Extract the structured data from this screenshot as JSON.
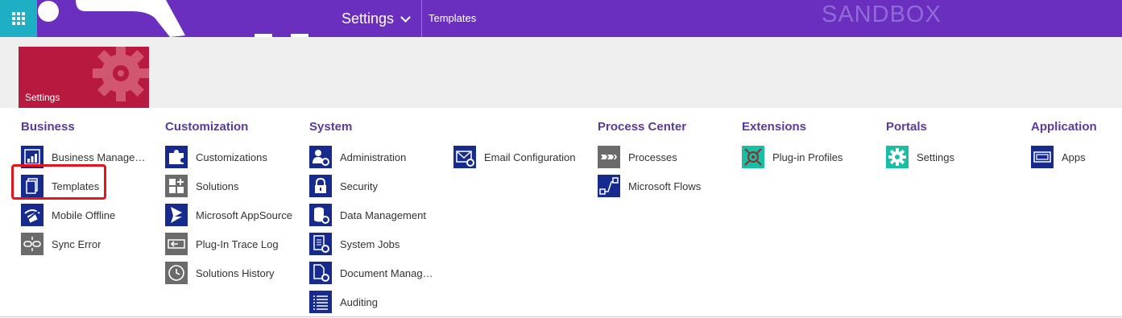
{
  "topbar": {
    "nav_label": "Settings",
    "breadcrumb": "Templates",
    "environment": "SANDBOX",
    "colors": {
      "bar": "#6B2FBF",
      "waffle": "#1FAFC4"
    }
  },
  "tile": {
    "label": "Settings",
    "color": "#B8193F"
  },
  "groups": {
    "business": {
      "title": "Business",
      "items": [
        {
          "label": "Business Manageme...",
          "icon": "business-management-icon"
        },
        {
          "label": "Templates",
          "icon": "templates-icon"
        },
        {
          "label": "Mobile Offline",
          "icon": "mobile-offline-icon"
        },
        {
          "label": "Sync Error",
          "icon": "sync-error-icon"
        }
      ]
    },
    "customization": {
      "title": "Customization",
      "items": [
        {
          "label": "Customizations",
          "icon": "puzzle-icon"
        },
        {
          "label": "Solutions",
          "icon": "solutions-icon"
        },
        {
          "label": "Microsoft AppSource",
          "icon": "appsource-icon"
        },
        {
          "label": "Plug-In Trace Log",
          "icon": "trace-log-icon"
        },
        {
          "label": "Solutions History",
          "icon": "history-icon"
        }
      ]
    },
    "system": {
      "title": "System",
      "items": [
        {
          "label": "Administration",
          "icon": "administration-icon"
        },
        {
          "label": "Security",
          "icon": "lock-icon"
        },
        {
          "label": "Data Management",
          "icon": "data-management-icon"
        },
        {
          "label": "System Jobs",
          "icon": "system-jobs-icon"
        },
        {
          "label": "Document Manage...",
          "icon": "document-management-icon"
        },
        {
          "label": "Auditing",
          "icon": "auditing-icon"
        }
      ],
      "extra_items": [
        {
          "label": "Email Configuration",
          "icon": "email-config-icon"
        }
      ]
    },
    "process_center": {
      "title": "Process Center",
      "items": [
        {
          "label": "Processes",
          "icon": "processes-icon"
        },
        {
          "label": "Microsoft Flows",
          "icon": "flow-icon"
        }
      ]
    },
    "extensions": {
      "title": "Extensions",
      "items": [
        {
          "label": "Plug-in Profiles",
          "icon": "plugin-profiles-icon"
        }
      ]
    },
    "portals": {
      "title": "Portals",
      "items": [
        {
          "label": "Settings",
          "icon": "gear-icon"
        }
      ]
    },
    "application": {
      "title": "Application",
      "items": [
        {
          "label": "Apps",
          "icon": "apps-icon"
        }
      ]
    }
  },
  "accent": {
    "section_title": "#5B3A9B",
    "icon_navy": "#172B8E",
    "icon_gray": "#6B6B6B",
    "icon_teal": "#19BFA4",
    "highlight": "#E8141B"
  }
}
